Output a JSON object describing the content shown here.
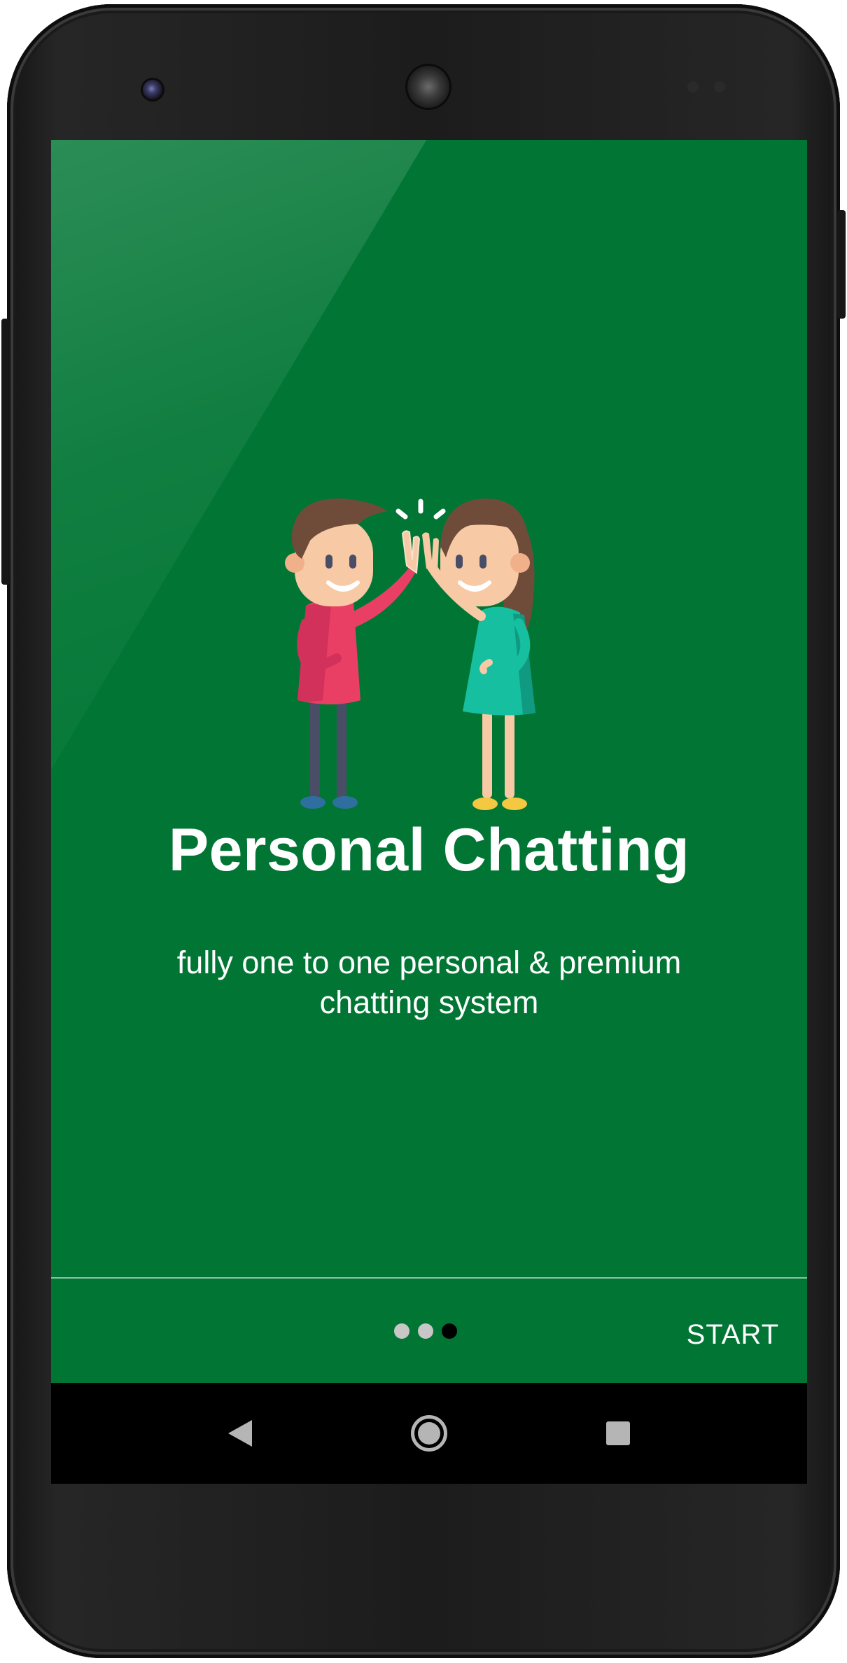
{
  "onboarding": {
    "title": "Personal Chatting",
    "description": "fully one to one personal & premium chatting system",
    "page_indicator": {
      "total": 3,
      "current": 3
    },
    "start_label": "START",
    "illustration": "high-five-illustration"
  },
  "navigation_bar": {
    "buttons": [
      "back-icon",
      "home-icon",
      "recents-icon"
    ]
  },
  "colors": {
    "background": "#017634",
    "text": "#ffffff",
    "indicator_inactive": "#c7c7c7",
    "indicator_active": "#000000",
    "nav_bar": "#000000"
  }
}
